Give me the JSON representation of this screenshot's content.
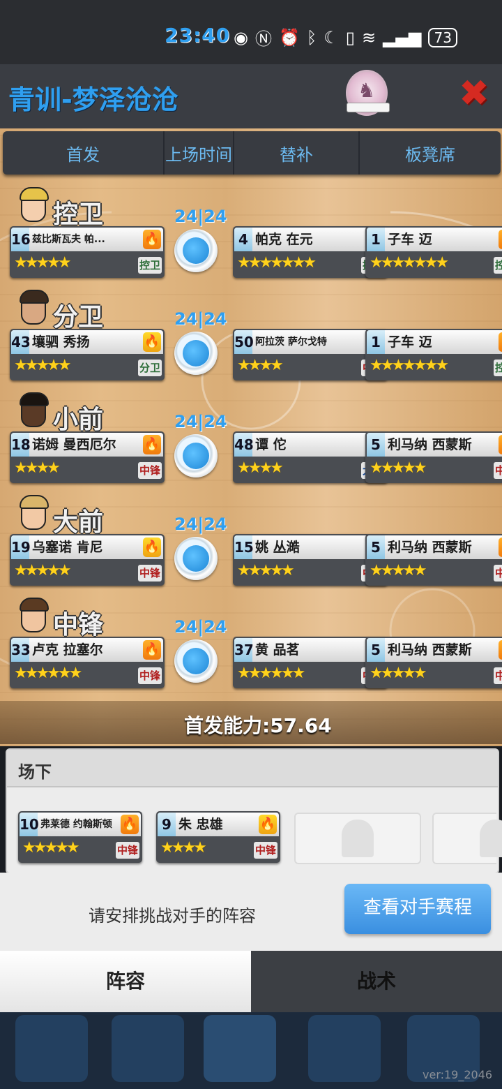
{
  "status_bar": {
    "time": "23:40",
    "battery": "73"
  },
  "header": {
    "title": "青训-梦泽沧沧"
  },
  "tabs": [
    "首发",
    "上场时间",
    "替补",
    "板凳席"
  ],
  "rows": [
    {
      "position": "控卫",
      "time": "24|24",
      "starter": {
        "num": "16",
        "name": "兹比斯瓦夫 帕...",
        "stars": "★★★★★",
        "pos": "控卫"
      },
      "sub1": {
        "num": "4",
        "name": "帕克 在元",
        "stars": "★★★★★★★",
        "pos": "控卫"
      },
      "sub2": {
        "num": "1",
        "name": "子车 迈",
        "stars": "★★★★★★★",
        "pos": "控卫"
      }
    },
    {
      "position": "分卫",
      "time": "24|24",
      "starter": {
        "num": "43",
        "name": "壤驷 秀扬",
        "stars": "★★★★★",
        "pos": "分卫"
      },
      "sub1": {
        "num": "50",
        "name": "阿拉茨 萨尔戈特",
        "stars": "★★★★",
        "pos": "中锋"
      },
      "sub2": {
        "num": "1",
        "name": "子车 迈",
        "stars": "★★★★★★★",
        "pos": "控卫"
      }
    },
    {
      "position": "小前",
      "time": "24|24",
      "starter": {
        "num": "18",
        "name": "诺姆 曼西厄尔",
        "stars": "★★★★",
        "pos": "中锋"
      },
      "sub1": {
        "num": "48",
        "name": "谭 佗",
        "stars": "★★★★",
        "pos": "大前"
      },
      "sub2": {
        "num": "5",
        "name": "利马纳 西蒙斯",
        "stars": "★★★★★",
        "pos": "中锋"
      }
    },
    {
      "position": "大前",
      "time": "24|24",
      "starter": {
        "num": "19",
        "name": "乌塞诺 肯尼",
        "stars": "★★★★★",
        "pos": "中锋"
      },
      "sub1": {
        "num": "15",
        "name": "姚 丛澔",
        "stars": "★★★★★",
        "pos": "中锋"
      },
      "sub2": {
        "num": "5",
        "name": "利马纳 西蒙斯",
        "stars": "★★★★★",
        "pos": "中锋"
      }
    },
    {
      "position": "中锋",
      "time": "24|24",
      "starter": {
        "num": "33",
        "name": "卢克 拉塞尔",
        "stars": "★★★★★★",
        "pos": "中锋"
      },
      "sub1": {
        "num": "37",
        "name": "黄 品茗",
        "stars": "★★★★★★",
        "pos": "中锋"
      },
      "sub2": {
        "num": "5",
        "name": "利马纳 西蒙斯",
        "stars": "★★★★★",
        "pos": "中锋"
      }
    }
  ],
  "power": "首发能力:57.64",
  "bench": {
    "title": "场下",
    "players": [
      {
        "num": "10",
        "name": "弗莱德 约翰斯顿",
        "stars": "★★★★★",
        "pos": "中锋"
      },
      {
        "num": "9",
        "name": "朱 忠雄",
        "stars": "★★★★",
        "pos": "中锋"
      }
    ]
  },
  "footer": {
    "message": "请安排挑战对手的阵容",
    "button": "查看对手赛程"
  },
  "bottom_tabs": [
    "阵容",
    "战术"
  ],
  "version": "ver:19_2046",
  "icons": {
    "close": "close-x-icon",
    "team_logo": "unicorn-logo-icon",
    "flame": "flame-icon"
  },
  "colors": {
    "accent": "#2f9ff0",
    "close": "#d52a21",
    "flame": "#f07a0c"
  }
}
